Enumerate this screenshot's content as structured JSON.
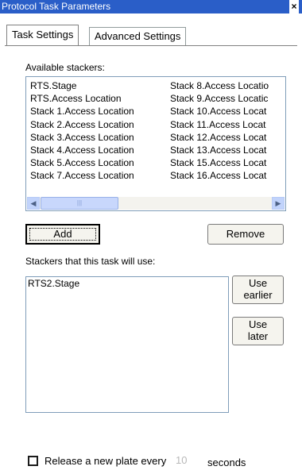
{
  "window": {
    "title": "Protocol Task Parameters",
    "close_glyph": "×"
  },
  "tabs": [
    {
      "label": "Task Settings",
      "active": true
    },
    {
      "label": "Advanced Settings",
      "active": false
    }
  ],
  "available": {
    "label": "Available stackers:",
    "column1": [
      "RTS.Stage",
      "RTS.Access Location",
      "Stack 1.Access Location",
      "Stack 2.Access Location",
      "Stack 3.Access Location",
      "Stack 4.Access Location",
      "Stack 5.Access Location",
      "Stack 7.Access Location"
    ],
    "column2": [
      "Stack 8.Access Locatio",
      "Stack 9.Access Locatic",
      "Stack 10.Access Locat",
      "Stack 11.Access Locat",
      "Stack 12.Access Locat",
      "Stack 13.Access Locat",
      "Stack 15.Access Locat",
      "Stack 16.Access Locat"
    ]
  },
  "buttons": {
    "add": "Add",
    "remove": "Remove",
    "use_earlier": [
      "Use",
      "earlier"
    ],
    "use_later": [
      "Use",
      "later"
    ]
  },
  "used": {
    "label": "Stackers that this task will use:",
    "items": [
      "RTS2.Stage"
    ]
  },
  "release": {
    "label_before": "Release a new plate every",
    "value": "10",
    "label_after": "seconds",
    "checked": false
  },
  "colors": {
    "titlebar": "#2a5ec8",
    "list_border": "#7f9db9",
    "scrollbar": "#c1d3fb"
  }
}
